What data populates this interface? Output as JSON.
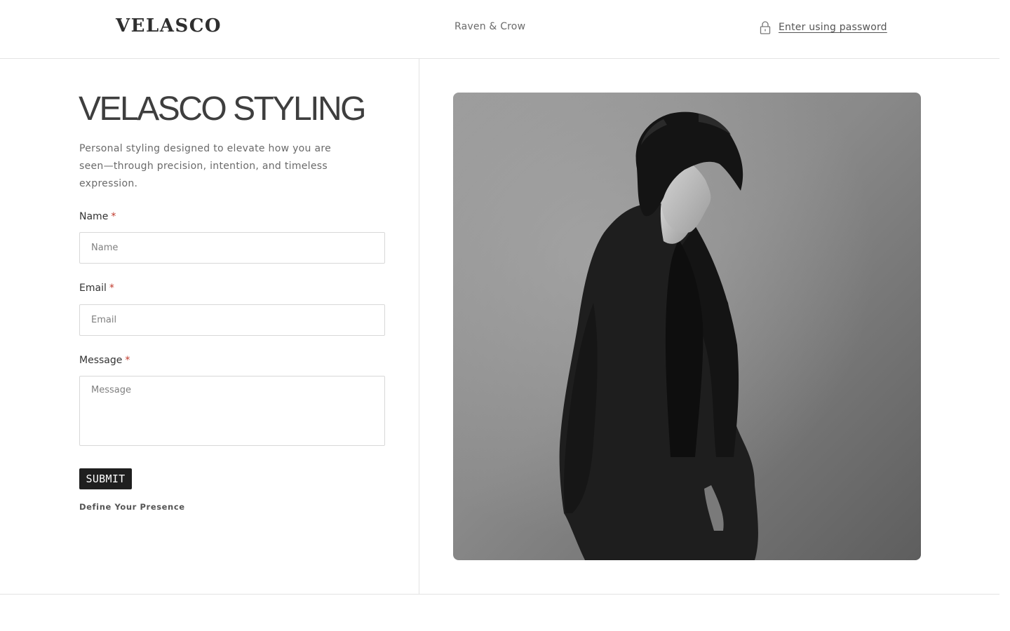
{
  "header": {
    "logo": "VELASCO",
    "store_name": "Raven & Crow",
    "password_link": "Enter using password",
    "lock_icon": "lock-icon"
  },
  "hero": {
    "title": "VELASCO STYLING",
    "description": "Personal styling designed to elevate how you are seen—through precision, intention, and timeless expression."
  },
  "form": {
    "name_label": "Name",
    "name_placeholder": "Name",
    "email_label": "Email",
    "email_placeholder": "Email",
    "message_label": "Message",
    "message_placeholder": "Message",
    "required_mark": "*",
    "submit_label": "SUBMIT",
    "tagline": "Define Your Presence"
  },
  "colors": {
    "accent_dark": "#1f1f1f",
    "required": "#c0392b",
    "border": "#e3e3e3"
  }
}
